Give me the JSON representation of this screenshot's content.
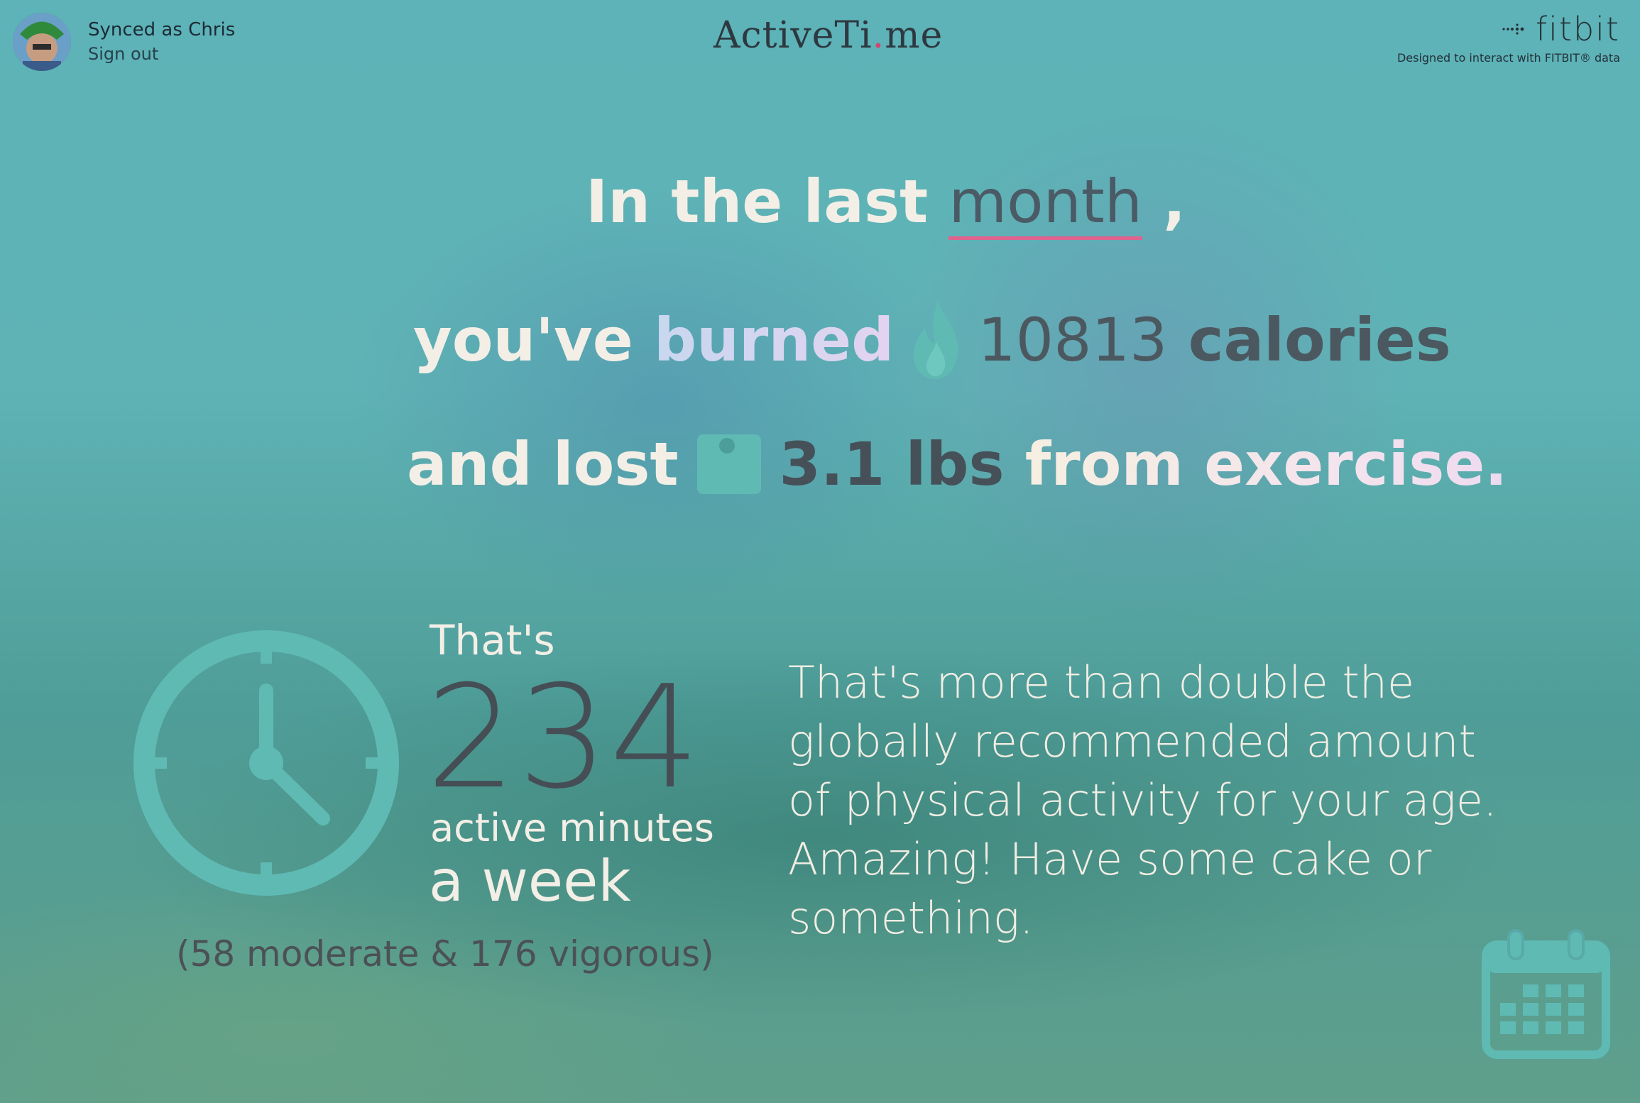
{
  "user": {
    "synced_text": "Synced as Chris",
    "signout_label": "Sign out"
  },
  "brand": {
    "part1": "ActiveTi",
    "dot": ".",
    "part2": "me"
  },
  "fitbit": {
    "logo_text": "fitbit",
    "subtitle": "Designed to interact with FITBIT® data"
  },
  "headline": {
    "line1_prefix": "In the last",
    "period": "month",
    "line1_suffix": ",",
    "line2_prefix": "you've",
    "burned": "burned",
    "calories_value": "10813",
    "calories_unit": "calories",
    "line3_prefix": "and lost",
    "lbs_value": "3.1 lbs",
    "exercise_suffix": "from exercise."
  },
  "activity": {
    "thats": "That's",
    "minutes": "234",
    "minutes_label": "active minutes",
    "per_label": "a week",
    "breakdown": "(58 moderate & 176 vigorous)"
  },
  "message": "That's more than double the globally recommended amount of physical activity for your age. Amazing! Have some cake or something.",
  "colors": {
    "accent_underline": "#e0628e",
    "icon_teal": "#5fbab4",
    "text_light": "#f3efe6",
    "text_dark": "#4c5860"
  },
  "icons": [
    "avatar",
    "fitbit-logo-icon",
    "flame-icon",
    "scale-icon",
    "clock-icon",
    "calendar-icon"
  ]
}
